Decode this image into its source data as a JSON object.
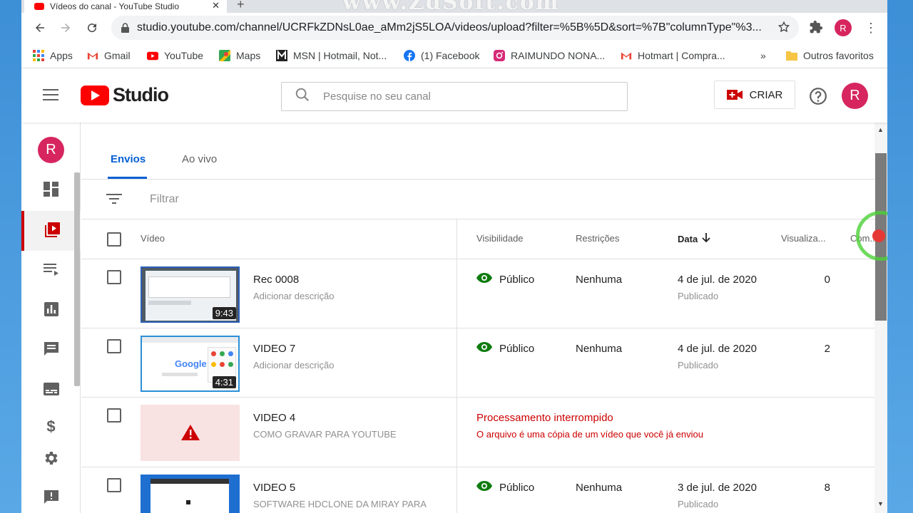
{
  "browser": {
    "tab_title": "Vídeos do canal - YouTube Studio",
    "watermark": "www.ZdSoft.com",
    "url": "studio.youtube.com/channel/UCRFkZDNsL0ae_aMm2jS5LOA/videos/upload?filter=%5B%5D&sort=%7B\"columnType\"%3...",
    "profile_initial": "R",
    "bookmarks": [
      {
        "label": "Apps"
      },
      {
        "label": "Gmail"
      },
      {
        "label": "YouTube"
      },
      {
        "label": "Maps"
      },
      {
        "label": "MSN | Hotmail, Not..."
      },
      {
        "label": "(1) Facebook"
      },
      {
        "label": "RAIMUNDO NONA..."
      },
      {
        "label": "Hotmart | Compra..."
      }
    ],
    "more_bookmarks": "»",
    "other_bookmarks": "Outros favoritos"
  },
  "studio": {
    "logo_word": "Studio",
    "search_placeholder": "Pesquise no seu canal",
    "create_label": "CRIAR",
    "avatar_initial": "R"
  },
  "content": {
    "tabs": [
      "Envios",
      "Ao vivo"
    ],
    "filter_placeholder": "Filtrar",
    "columns": {
      "video": "Vídeo",
      "visibility": "Visibilidade",
      "restrictions": "Restrições",
      "date": "Data",
      "views": "Visualiza...",
      "comments": "Com..."
    },
    "rows": [
      {
        "title": "Rec 0008",
        "desc": "Adicionar descrição",
        "duration": "9:43",
        "visibility": "Público",
        "restrictions": "Nenhuma",
        "date": "4 de jul. de 2020",
        "date_status": "Publicado",
        "views": "0"
      },
      {
        "title": "VIDEO 7",
        "desc": "Adicionar descrição",
        "duration": "4:31",
        "visibility": "Público",
        "restrictions": "Nenhuma",
        "date": "4 de jul. de 2020",
        "date_status": "Publicado",
        "views": "2"
      },
      {
        "title": "VIDEO 4",
        "desc": "COMO GRAVAR PARA YOUTUBE",
        "error_title": "Processamento interrompido",
        "error_desc": "O arquivo é uma cópia de um vídeo que você já enviou"
      },
      {
        "title": "VIDEO 5",
        "desc": "SOFTWARE HDCLONE DA MIRAY PARA",
        "visibility": "Público",
        "restrictions": "Nenhuma",
        "date": "3 de jul. de 2020",
        "date_status": "Publicado",
        "views": "8"
      }
    ]
  },
  "thumb_google_text": "Google",
  "colors": {
    "accent": "#065fd4",
    "youtube_red": "#ff0000",
    "avatar": "#d6255f",
    "public_green": "#0f7c0f",
    "error_red": "#cc0000"
  }
}
